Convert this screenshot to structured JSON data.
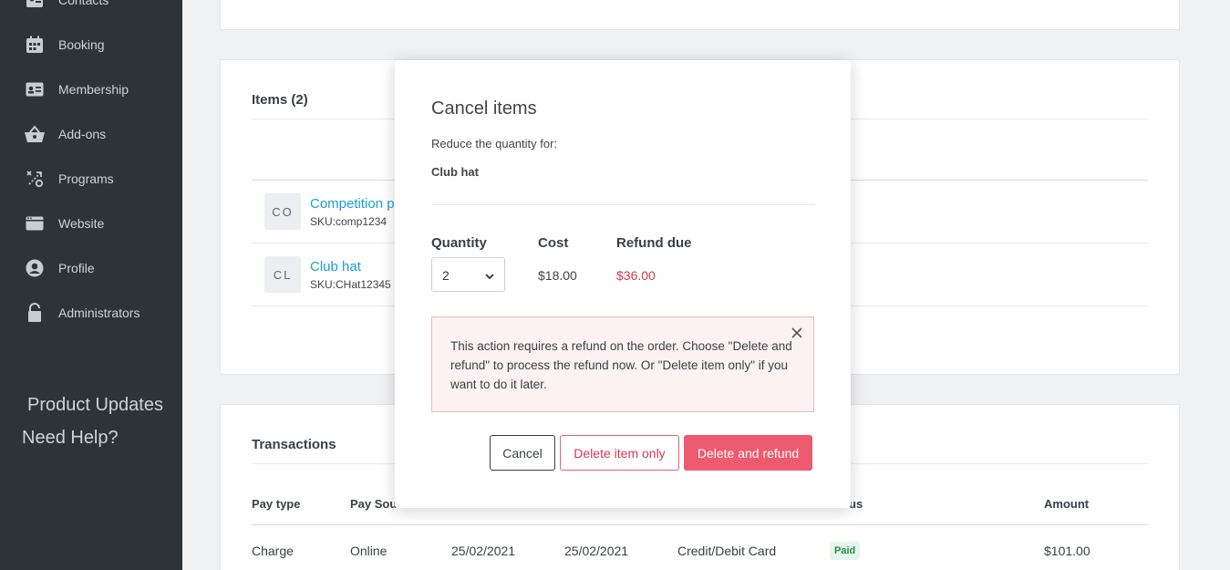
{
  "sidebar": {
    "items": [
      {
        "label": "Contacts",
        "icon": "contacts-icon"
      },
      {
        "label": "Booking",
        "icon": "calendar-icon"
      },
      {
        "label": "Membership",
        "icon": "id-card-icon"
      },
      {
        "label": "Add-ons",
        "icon": "basket-icon"
      },
      {
        "label": "Programs",
        "icon": "programs-icon"
      },
      {
        "label": "Website",
        "icon": "browser-icon"
      },
      {
        "label": "Profile",
        "icon": "user-circle-icon"
      },
      {
        "label": "Administrators",
        "icon": "lock-icon"
      }
    ],
    "product_updates": "Product Updates",
    "need_help": "Need Help?"
  },
  "items_card": {
    "title": "Items (2)",
    "items": [
      {
        "initials": "CO",
        "name": "Competition p",
        "sku": "SKU:comp1234"
      },
      {
        "initials": "CL",
        "name": "Club hat",
        "sku": "SKU:CHat12345"
      }
    ]
  },
  "transactions": {
    "title": "Transactions",
    "headers": [
      "Pay type",
      "Pay Sour",
      "us",
      "Amount"
    ],
    "row": {
      "pay_type": "Charge",
      "pay_source": "Online",
      "date1": "25/02/2021",
      "date2": "25/02/2021",
      "method": "Credit/Debit Card",
      "status": "Paid",
      "amount": "$101.00"
    }
  },
  "modal": {
    "title": "Cancel items",
    "subtitle": "Reduce the quantity for:",
    "item_name": "Club hat",
    "columns": {
      "quantity": "Quantity",
      "cost": "Cost",
      "refund": "Refund due"
    },
    "quantity": "2",
    "cost": "$18.00",
    "refund_due": "$36.00",
    "alert": "This action requires a refund on the order. Choose \"Delete and refund\" to process the refund now. Or \"Delete item only\" if you want to do it later.",
    "buttons": {
      "cancel": "Cancel",
      "delete_only": "Delete item only",
      "delete_refund": "Delete and refund"
    }
  },
  "colors": {
    "sidebar": "#2e3337",
    "link": "#1a9fd0",
    "danger": "#ee5a6f",
    "refund_text": "#d4384f"
  }
}
